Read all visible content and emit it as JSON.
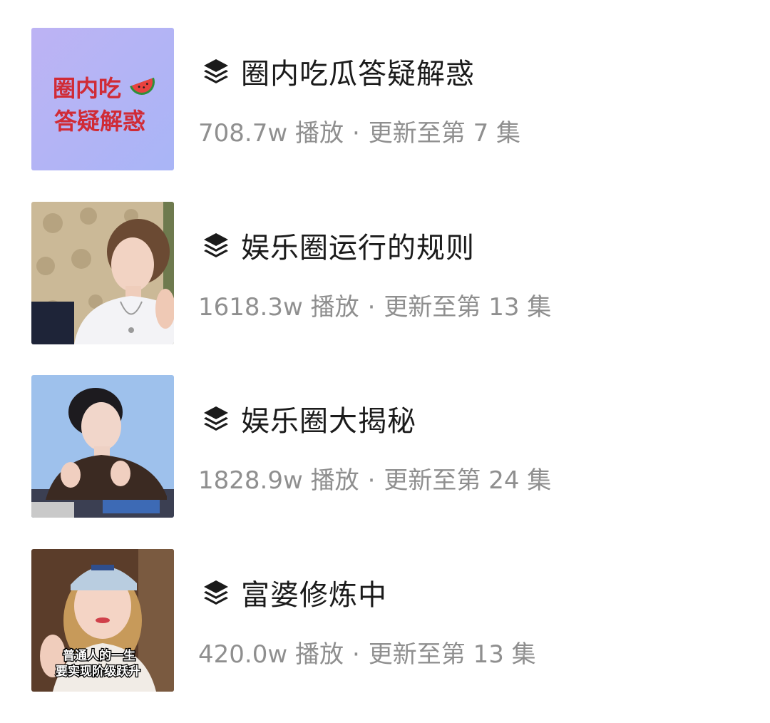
{
  "items": [
    {
      "title": "圈内吃瓜答疑解惑",
      "plays": "708.7w 播放",
      "update": "更新至第 7 集",
      "thumbnail": {
        "text_line1": "圈内吃",
        "text_line2": "答疑解惑",
        "bg_color": "#b5b0f5",
        "text_color": "#d02b36",
        "icon": "watermelon-icon"
      }
    },
    {
      "title": "娱乐圈运行的规则",
      "plays": "1618.3w 播放",
      "update": "更新至第 13 集",
      "thumbnail": {
        "scene": "woman-in-white-sweater-portrait"
      }
    },
    {
      "title": "娱乐圈大揭秘",
      "plays": "1828.9w 播放",
      "update": "更新至第 24 集",
      "thumbnail": {
        "scene": "woman-with-short-hair-blue-background"
      }
    },
    {
      "title": "富婆修炼中",
      "plays": "420.0w 播放",
      "update": "更新至第 13 集",
      "thumbnail": {
        "scene": "woman-in-cap-portrait",
        "caption_line1": "普通人的一生",
        "caption_line2": "要实现阶级跃升"
      }
    }
  ],
  "separator": "·",
  "icons": {
    "collection": "layers-icon"
  },
  "colors": {
    "title": "#1b1b1b",
    "meta": "#8f8f8f",
    "background": "#ffffff"
  }
}
